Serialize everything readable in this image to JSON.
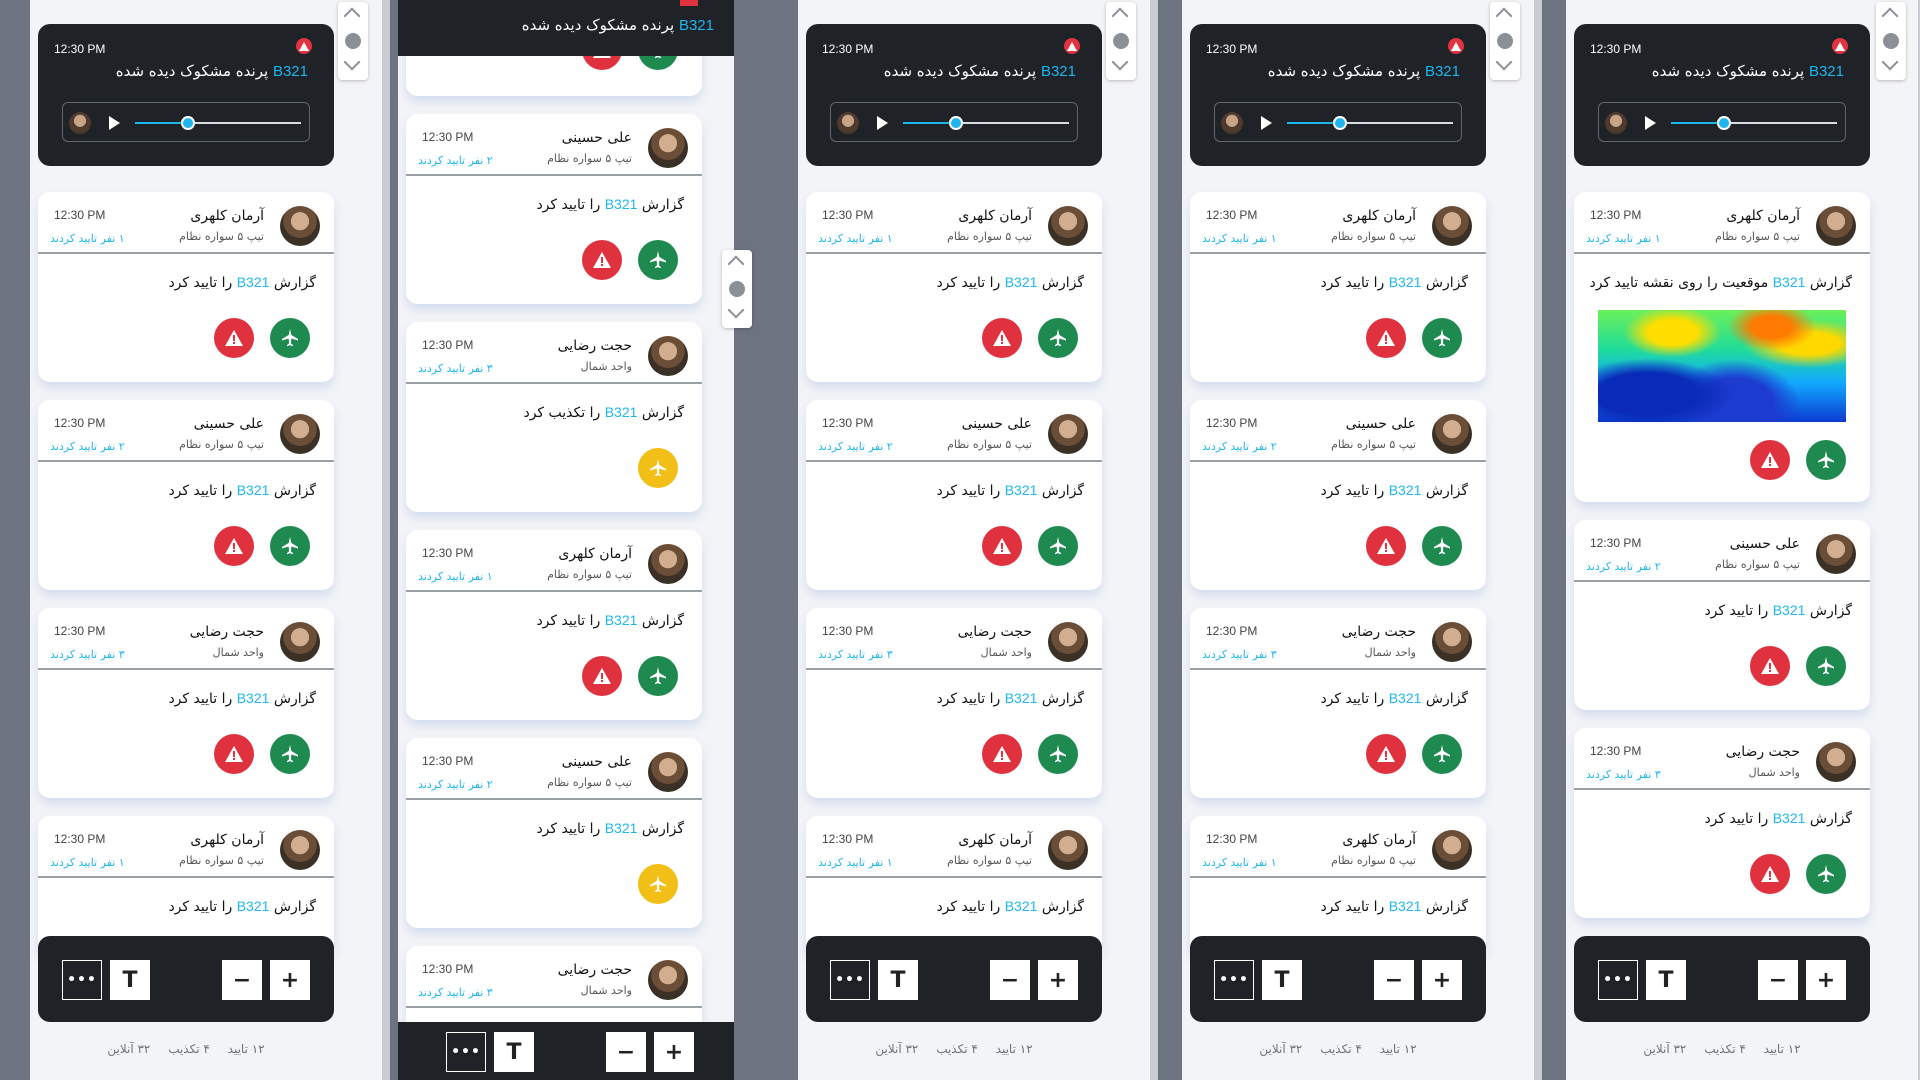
{
  "colors": {
    "accent": "#1fb6f0",
    "approve": "#1e8a4f",
    "reject": "#e0313f",
    "warn": "#f2bf16",
    "dark": "#1f2226"
  },
  "header": {
    "time": "12:30 PM",
    "code": "B321",
    "title_text": "پرنده مشکوک دیده شده",
    "audio_progress": 0.32
  },
  "icons": {
    "alert": "alert-triangle-icon",
    "approve": "airplane-icon",
    "reject": "alert-triangle-icon",
    "audio_avatar": "avatar-icon",
    "play": "play-icon"
  },
  "report": {
    "prefix": "گزارش",
    "code": "B321",
    "approved_suffix": "را تایید کرد",
    "denied_suffix": "را تکذیب کرد",
    "map_suffix": "موقعیت را روی نقشه تایید کرد"
  },
  "people": {
    "arman": {
      "name": "آرمان کلهری",
      "unit": "تیپ ۵ سواره نظام",
      "confirms": "۱ نفر تایید کردند",
      "time": "12:30 PM"
    },
    "ali": {
      "name": "علی حسینی",
      "unit": "تیپ ۵ سواره نظام",
      "confirms": "۲ نفر تایید کردند",
      "time": "12:30 PM"
    },
    "hojat": {
      "name": "حجت رضایی",
      "unit": "واحد شمال",
      "confirms": "۳ نفر تایید کردند",
      "time": "12:30 PM"
    }
  },
  "toolbar": {
    "more": "•••",
    "text_tool": "T",
    "zoom_out": "−",
    "zoom_in": "+"
  },
  "footer": {
    "approved": "۱۲ تایید",
    "denied": "۴ تکذیب",
    "online": "۳۲ آنلاین"
  }
}
